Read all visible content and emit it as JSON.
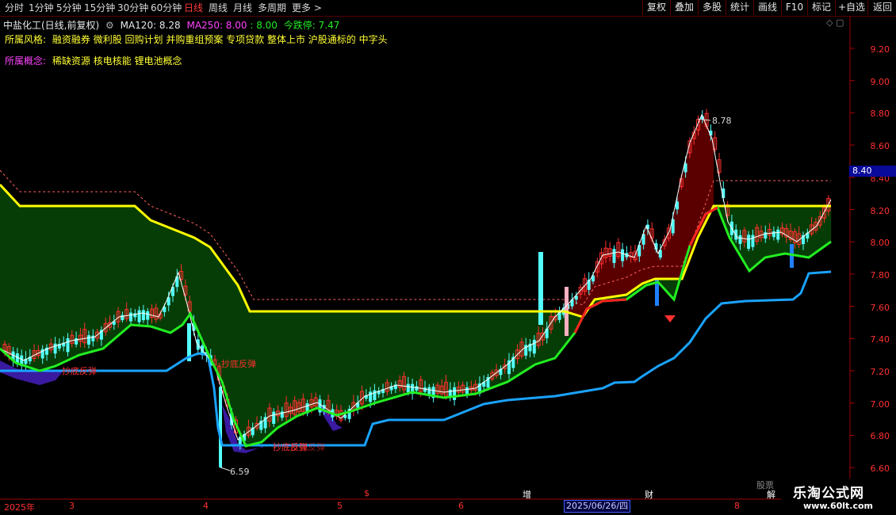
{
  "toolbar": {
    "timeframes": [
      {
        "label": "分时",
        "active": false
      },
      {
        "label": "1分钟",
        "active": false
      },
      {
        "label": "5分钟",
        "active": false
      },
      {
        "label": "15分钟",
        "active": false
      },
      {
        "label": "30分钟",
        "active": false
      },
      {
        "label": "60分钟",
        "active": false
      },
      {
        "label": "日线",
        "active": true
      },
      {
        "label": "周线",
        "active": false
      },
      {
        "label": "月线",
        "active": false
      },
      {
        "label": "多周期",
        "active": false
      },
      {
        "label": "更多 >",
        "active": false
      }
    ],
    "right_buttons": [
      "复权",
      "叠加",
      "多股",
      "统计",
      "画线",
      "F10",
      "标记",
      "+自选",
      "返回"
    ]
  },
  "header": {
    "stock_title": "中盐化工(日线,前复权)",
    "ma120_label": "MA120: 8.28",
    "ma250_label": "MA250: 8.00",
    "extra_value": ": 8.00",
    "limit_down": "今跌停: 7.47"
  },
  "styles": {
    "label": "所属风格:",
    "text": "融资融券 微利股 回购计划 并购重组预案 专项贷款 整体上市 沪股通标的 中字头"
  },
  "concepts": {
    "label": "所属概念:",
    "text": "稀缺资源 核电核能 锂电池概念"
  },
  "price_axis": [
    "9.20",
    "9.00",
    "8.80",
    "8.60",
    "8.40",
    "8.20",
    "8.00",
    "7.80",
    "7.60",
    "7.40",
    "7.20",
    "7.00",
    "6.80",
    "6.60"
  ],
  "current_price": "8.40",
  "annotations": {
    "high": "8.78",
    "low": "6.59",
    "signal1": "抄底反弹",
    "signal2": "抄底反弹",
    "signal3": "抄底反弹",
    "signal3b": "抄底反弹"
  },
  "date_axis": {
    "year": "2025年",
    "months": [
      "3",
      "4",
      "5",
      "6",
      "8"
    ],
    "current_date": "2025/06/26/四",
    "markers": [
      "$",
      "增",
      "财",
      "解",
      "股票"
    ]
  },
  "watermark": {
    "line1": "乐淘公式网",
    "line2": "www.60lt.com"
  },
  "colors": {
    "up": "#ff3030",
    "down": "#54ffff",
    "ma_yellow": "#ffff00",
    "ma_green": "#22ee22",
    "ma_blue": "#1aa3ff",
    "fill_green": "#063d06",
    "fill_red": "#5a0000",
    "fill_purple": "#3a1aa0"
  }
}
